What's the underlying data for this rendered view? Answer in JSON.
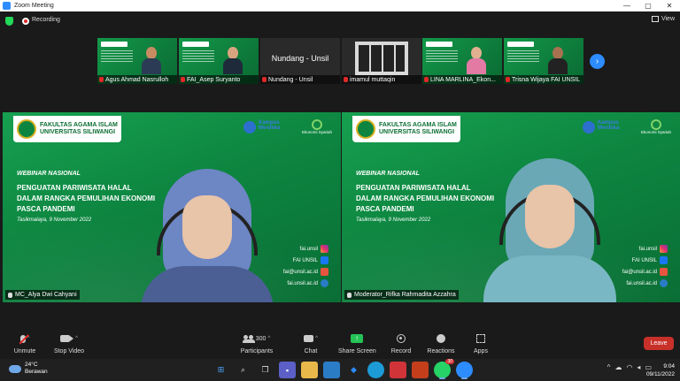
{
  "window": {
    "title": "Zoom Meeting",
    "controls": [
      "—",
      "▢",
      "✕"
    ]
  },
  "status": {
    "recording_label": "Recording",
    "view_label": "View"
  },
  "thumbnails": [
    {
      "name": "Agus Ahmad Nasrulloh",
      "type": "slide-person"
    },
    {
      "name": "FAI_Asep Suryanto",
      "type": "slide-person"
    },
    {
      "name": "Nundang - Unsil",
      "display_name": "Nundang - Unsil",
      "type": "name-only"
    },
    {
      "name": "imamul muttaqin",
      "type": "keyboard"
    },
    {
      "name": "LINA MARLINA_Ekon...",
      "type": "slide-person"
    },
    {
      "name": "Trisna Wijaya FAI UNSIL",
      "type": "slide-person"
    }
  ],
  "slide": {
    "org_line1": "FAKULTAS AGAMA ISLAM",
    "org_line2": "UNIVERSITAS SILIWANGI",
    "kampus": "Kampus Merdeka",
    "ekonomi": "Ekonomi Syariah",
    "webinar": "WEBINAR NASIONAL",
    "headline_line1": "PENGUATAN PARIWISATA HALAL",
    "headline_line2": "DALAM RANGKA PEMULIHAN EKONOMI",
    "headline_line3": "PASCA PANDEMI",
    "date": "Tasikmalaya, 9 November 2022",
    "contacts": [
      "fai.unsil",
      "FAI UNSIL",
      "fai@unsil.ac.id",
      "fai.unsil.ac.id"
    ]
  },
  "tiles": [
    {
      "name": "MC_Alya Dwi Cahyani",
      "active": true,
      "hijab_color": "#6d86c4",
      "body_color": "#4b5f95"
    },
    {
      "name": "Moderator_Rifka Rahmadita Azzahra",
      "active": false,
      "hijab_color": "#6aa8b6",
      "body_color": "#7ab7c4"
    }
  ],
  "toolbar": {
    "unmute": "Unmute",
    "stop_video": "Stop Video",
    "participants": "Participants",
    "participants_count": "300",
    "chat": "Chat",
    "share_screen": "Share Screen",
    "record": "Record",
    "reactions": "Reactions",
    "apps": "Apps",
    "leave": "Leave"
  },
  "taskbar": {
    "temperature": "24°C",
    "weather": "Berawan",
    "time": "9:04",
    "date": "09/11/2022",
    "whatsapp_badge": "30",
    "apps": [
      "windows-icon",
      "search-icon",
      "taskview-icon",
      "teams-icon",
      "explorer-icon",
      "mail-icon",
      "dropbox-icon",
      "edge-icon",
      "office-icon",
      "ppt-icon",
      "whatsapp-icon",
      "zoom-icon"
    ]
  }
}
